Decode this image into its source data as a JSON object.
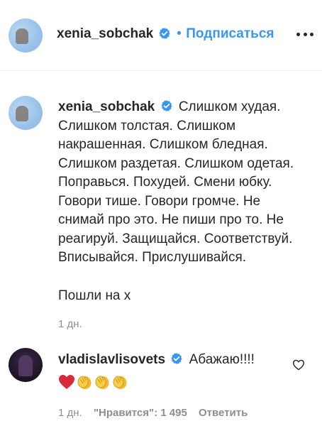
{
  "header": {
    "username": "xenia_sobchak",
    "separator": "•",
    "follow_label": "Подписаться"
  },
  "caption": {
    "username": "xenia_sobchak",
    "lines": [
      "Слишком худая.",
      "Слишком толстая. Слишком",
      "накрашенная. Слишком бледная.",
      "Слишком раздетая. Слишком одетая.",
      "Поправься. Похудей. Смени юбку.",
      "Говори тише. Говори громче. Не",
      "снимай про это. Не пиши про то. Не",
      "реагируй. Защищайся. Соответствуй.",
      "Вписывайся. Прислушивайся.",
      "Пошли на х"
    ],
    "time": "1 дн."
  },
  "comment": {
    "username": "vladislavlisovets",
    "text": "Абажаю!!!!",
    "emojis": [
      "heart",
      "clap",
      "clap",
      "clap"
    ],
    "time": "1 дн.",
    "likes_label": "\"Нравится\": 1 495",
    "reply_label": "Ответить"
  },
  "colors": {
    "link_blue": "#3897f0",
    "text_dark": "#262626",
    "text_gray": "#8e8e8e",
    "verified_blue": "#3897f0",
    "heart_red": "#ed4956",
    "clap_yellow": "#f5c43a"
  }
}
